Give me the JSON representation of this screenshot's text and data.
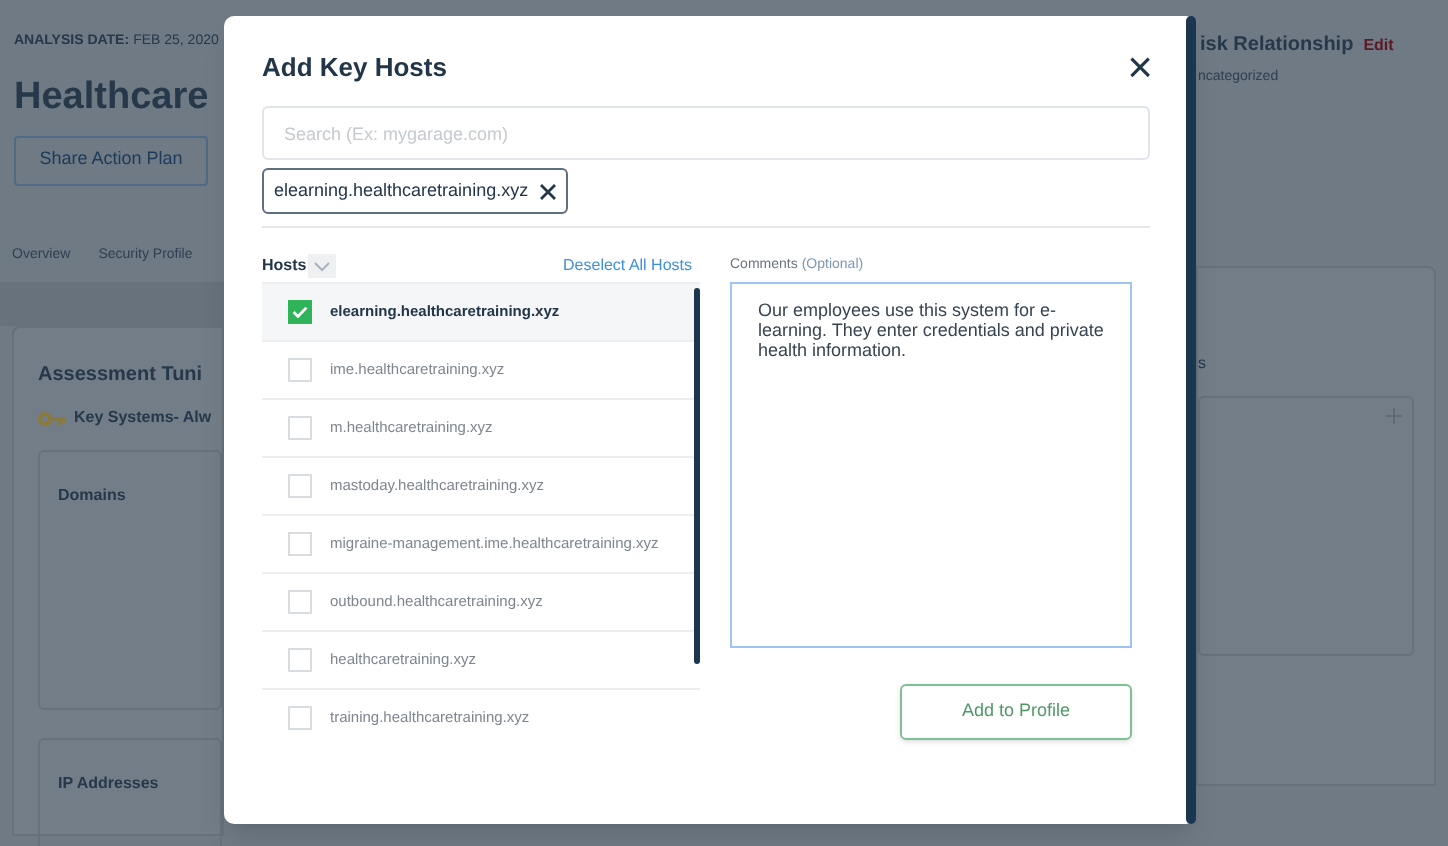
{
  "background": {
    "analysis_label": "ANALYSIS DATE:",
    "analysis_date": "FEB 25, 2020",
    "title": "Healthcare",
    "share_button": "Share Action Plan",
    "tabs": [
      {
        "label": "Overview"
      },
      {
        "label": "Security Profile"
      }
    ],
    "card_title": "Assessment Tuni",
    "key_systems": "Key Systems- Alw",
    "domains_title": "Domains",
    "ip_title": "IP Addresses",
    "risk_title": "isk Relationship",
    "edit_link": "Edit",
    "category": "ncategorized",
    "fragment": "s"
  },
  "modal": {
    "title": "Add Key Hosts",
    "close": "×",
    "search": {
      "placeholder": "Search (Ex: mygarage.com)"
    },
    "chips": [
      {
        "label": "elearning.healthcaretraining.xyz"
      }
    ],
    "hosts_label": "Hosts",
    "deselect_link": "Deselect All Hosts",
    "hosts": [
      {
        "name": "elearning.healthcaretraining.xyz",
        "checked": true
      },
      {
        "name": "ime.healthcaretraining.xyz",
        "checked": false
      },
      {
        "name": "m.healthcaretraining.xyz",
        "checked": false
      },
      {
        "name": "mastoday.healthcaretraining.xyz",
        "checked": false
      },
      {
        "name": "migraine-management.ime.healthcaretraining.xyz",
        "checked": false
      },
      {
        "name": "outbound.healthcaretraining.xyz",
        "checked": false
      },
      {
        "name": "healthcaretraining.xyz",
        "checked": false
      },
      {
        "name": "training.healthcaretraining.xyz",
        "checked": false
      }
    ],
    "comments_label": "Comments",
    "comments_optional": "(Optional)",
    "comments_value": "Our employees use this system for e-learning. They enter credentials and private health information.",
    "submit": "Add to Profile"
  }
}
